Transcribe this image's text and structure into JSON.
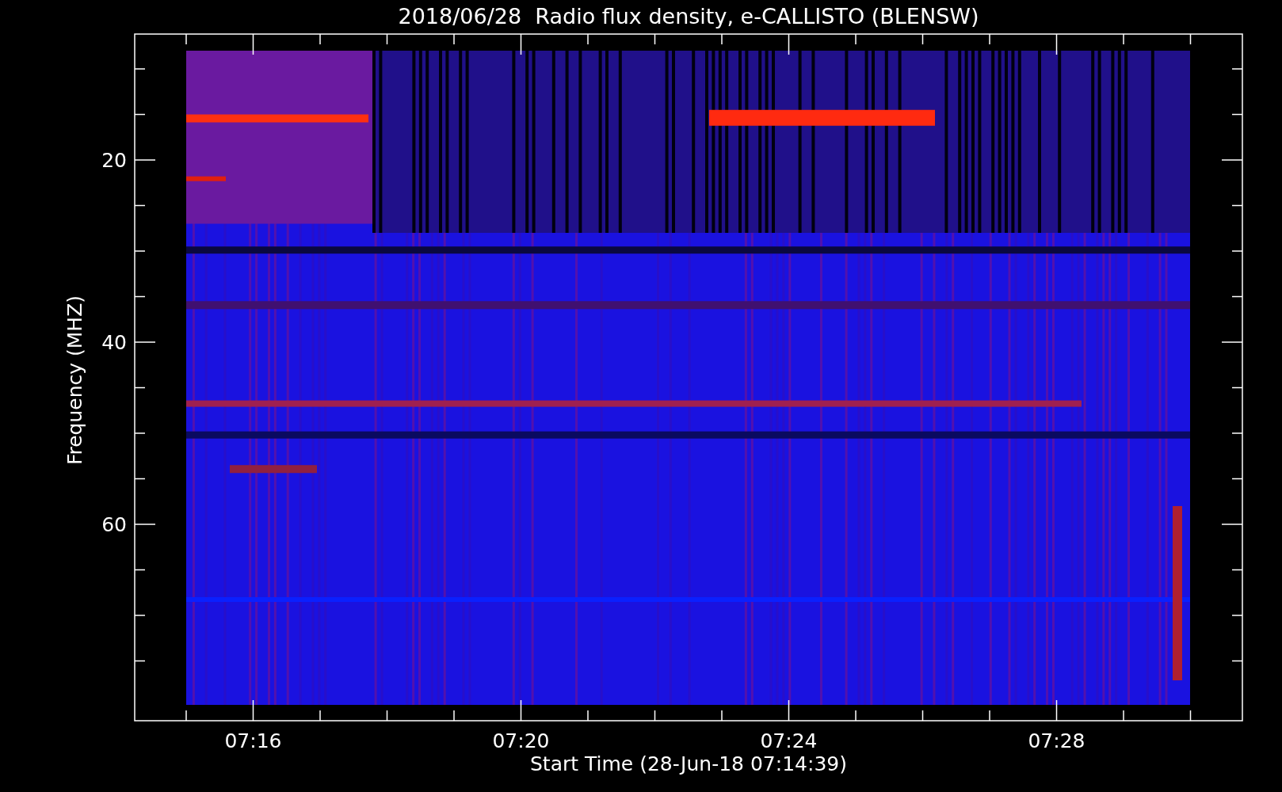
{
  "title": "2018/06/28  Radio flux density, e-CALLISTO (BLENSW)",
  "y_axis": {
    "label": "Frequency (MHZ)",
    "ticks": [
      "20",
      "40",
      "60"
    ]
  },
  "x_axis": {
    "label": "Start Time (28-Jun-18 07:14:39)",
    "ticks": [
      "07:16",
      "07:20",
      "07:24",
      "07:28"
    ]
  }
}
